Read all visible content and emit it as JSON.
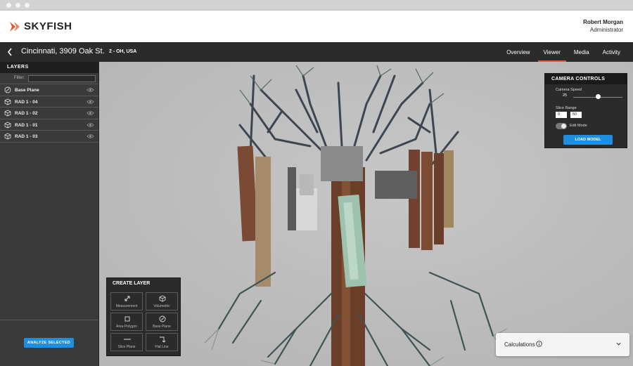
{
  "app": {
    "logo": "SKYFISH",
    "logo_color": "#e4572e",
    "accent": "#1e8fe0"
  },
  "user": {
    "name": "Robert Morgan",
    "role": "Administrator"
  },
  "location": {
    "back_icon": "chevron-left-icon",
    "title": "Cincinnati, 3909 Oak St.",
    "subtitle": "2 - OH, USA"
  },
  "tabs": [
    {
      "label": "Overview",
      "active": false
    },
    {
      "label": "Viewer",
      "active": true
    },
    {
      "label": "Media",
      "active": false
    },
    {
      "label": "Activity",
      "active": false
    }
  ],
  "layers_panel": {
    "title": "LAYERS",
    "filter_label": "Filter:",
    "filter_value": "",
    "items": [
      {
        "label": "Base Plane",
        "icon": "compass-icon"
      },
      {
        "label": "RAD 1 - 04",
        "icon": "cube-icon"
      },
      {
        "label": "RAD 1 - 02",
        "icon": "cube-icon"
      },
      {
        "label": "RAD 1 - 01",
        "icon": "cube-icon"
      },
      {
        "label": "RAD 1 - 03",
        "icon": "cube-icon"
      }
    ],
    "analyze_button": "ANALYZE SELECTED"
  },
  "camera_controls": {
    "title": "CAMERA CONTROLS",
    "speed_label": "Camera Speed",
    "speed_value": "25",
    "speed_fraction": 0.5,
    "slice_label": "Slice Range",
    "slice_min": "0",
    "slice_max": "50",
    "edit_mode_label": "Edit Mode",
    "edit_mode_on": true,
    "load_button": "LOAD MODEL"
  },
  "create_layer": {
    "title": "CREATE LAYER",
    "tools": [
      {
        "label": "Measurement",
        "icon": "diagonal-arrows-icon"
      },
      {
        "label": "Volumetric",
        "icon": "cube-icon"
      },
      {
        "label": "Area Polygon",
        "icon": "square-icon"
      },
      {
        "label": "Base Plane",
        "icon": "compass-icon"
      },
      {
        "label": "Slice Plane",
        "icon": "horizontal-line-icon"
      },
      {
        "label": "Flat Line",
        "icon": "corner-arrow-icon"
      }
    ]
  },
  "calculations": {
    "label": "Calculations",
    "info_icon": "info-icon",
    "chevron_icon": "chevron-down-icon"
  }
}
